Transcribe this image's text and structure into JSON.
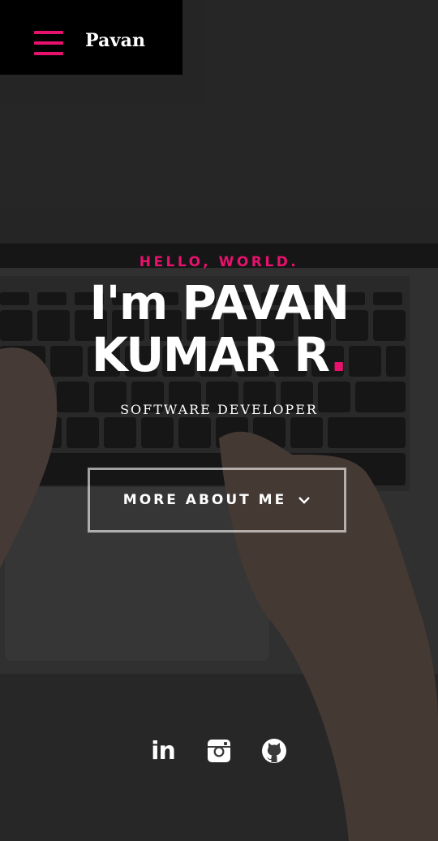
{
  "nav": {
    "brand": "Pavan",
    "menu_icon": "hamburger-menu-icon",
    "accent": "#e8116d"
  },
  "hero": {
    "greeting": "HELLO, WORLD.",
    "name_line1": "I'm PAVAN",
    "name_line2": "KUMAR R",
    "name_dot": ".",
    "role": "SOFTWARE DEVELOPER",
    "cta_label": "MORE ABOUT ME",
    "cta_icon": "chevron-down-icon"
  },
  "social": {
    "linkedin_text": "in",
    "items": [
      "linkedin-icon",
      "instagram-icon",
      "github-icon"
    ]
  },
  "colors": {
    "accent": "#e8116d",
    "nav_bg": "#000000",
    "text": "#ffffff"
  }
}
